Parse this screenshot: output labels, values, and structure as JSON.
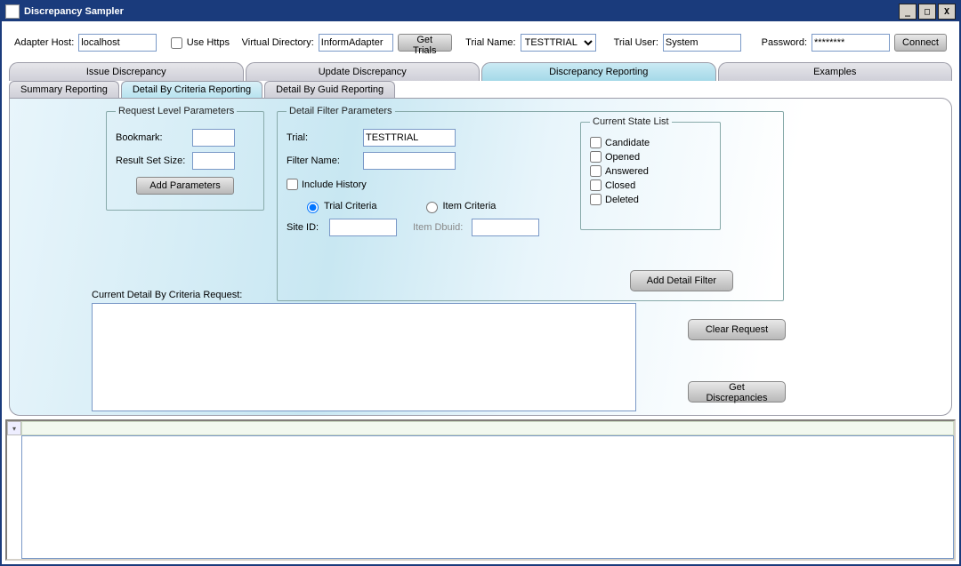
{
  "window": {
    "title": "Discrepancy Sampler"
  },
  "winctl": {
    "min": "_",
    "max": "□",
    "close": "X"
  },
  "top": {
    "adapter_host_label": "Adapter Host:",
    "adapter_host_value": "localhost",
    "use_https_label": "Use Https",
    "virtual_dir_label": "Virtual Directory:",
    "virtual_dir_value": "InformAdapter",
    "get_trials_label": "Get Trials",
    "trial_name_label": "Trial Name:",
    "trial_name_value": "TESTTRIAL",
    "trial_user_label": "Trial User:",
    "trial_user_value": "System",
    "password_label": "Password:",
    "password_value": "********",
    "connect_label": "Connect"
  },
  "tabs": {
    "main": [
      "Issue Discrepancy",
      "Update Discrepancy",
      "Discrepancy Reporting",
      "Examples"
    ],
    "sub": [
      "Summary Reporting",
      "Detail By Criteria Reporting",
      "Detail By Guid Reporting"
    ]
  },
  "req": {
    "legend": "Request Level Parameters",
    "bookmark_label": "Bookmark:",
    "bookmark_value": "",
    "result_set_label": "Result Set Size:",
    "result_set_value": "",
    "add_params_label": "Add Parameters"
  },
  "detail": {
    "legend": "Detail Filter Parameters",
    "trial_label": "Trial:",
    "trial_value": "TESTTRIAL",
    "filter_name_label": "Filter Name:",
    "filter_name_value": "",
    "include_history_label": "Include History",
    "trial_criteria_label": "Trial Criteria",
    "item_criteria_label": "Item Criteria",
    "site_id_label": "Site ID:",
    "site_id_value": "",
    "item_dbuid_label": "Item Dbuid:",
    "item_dbuid_value": "",
    "add_detail_label": "Add Detail Filter"
  },
  "states": {
    "legend": "Current State List",
    "items": [
      "Candidate",
      "Opened",
      "Answered",
      "Closed",
      "Deleted"
    ]
  },
  "current_request_label": "Current Detail By Criteria Request:",
  "actions": {
    "clear_label": "Clear Request",
    "get_label": "Get Discrepancies"
  },
  "dropdown_glyph": "▾"
}
